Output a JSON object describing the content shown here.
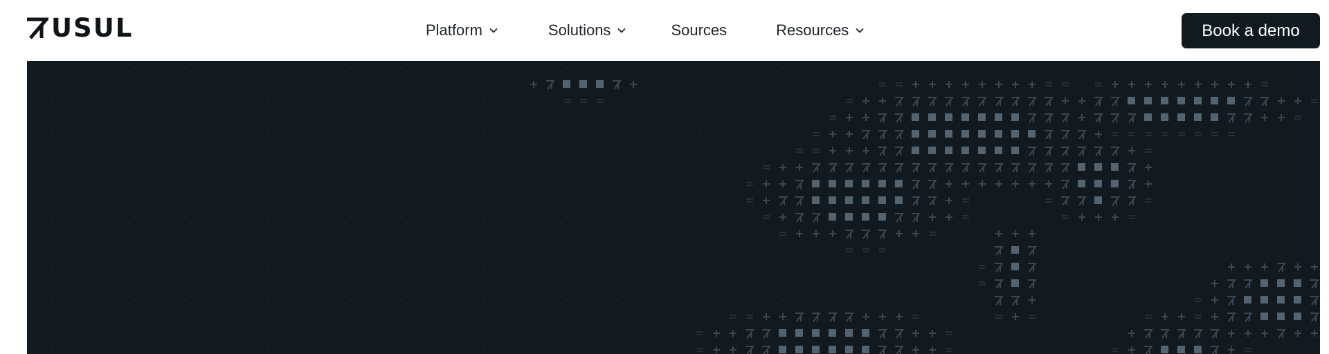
{
  "header": {
    "brand": {
      "name": "USUL",
      "mark_icon": "arrow-logo-icon"
    },
    "nav": [
      {
        "label": "Platform",
        "has_dropdown": true
      },
      {
        "label": "Solutions",
        "has_dropdown": true
      },
      {
        "label": "Sources",
        "has_dropdown": false
      },
      {
        "label": "Resources",
        "has_dropdown": true
      }
    ],
    "cta_label": "Book a demo"
  },
  "hero": {
    "background": "#121a20",
    "pattern_icon": "ascii-world-map-pattern",
    "pattern_glyphs": [
      "=",
      "+",
      "↗",
      "■"
    ]
  },
  "colors": {
    "brand_dark": "#111a1e",
    "text": "#1d2328",
    "hero_bg": "#121a20",
    "pattern_dim": "#2a3640",
    "pattern_mid": "#3a4752",
    "pattern_bright": "#536470"
  }
}
